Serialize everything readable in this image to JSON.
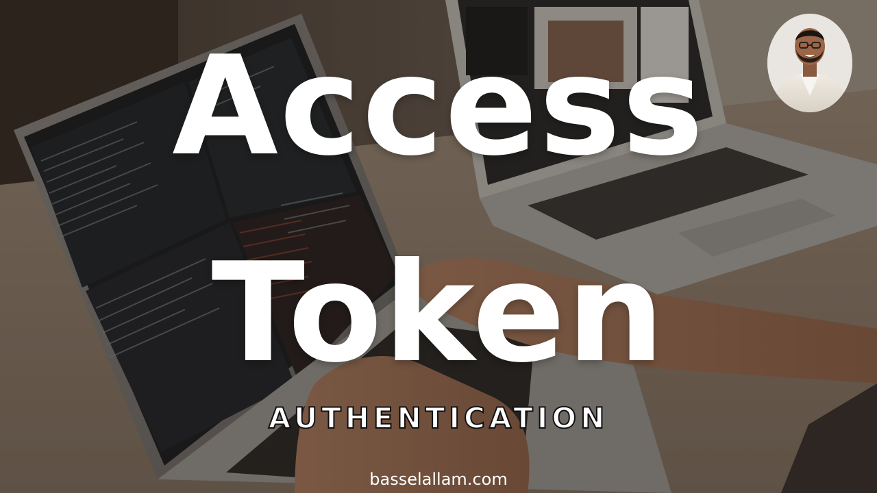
{
  "thumbnail": {
    "title_line_1": "Access",
    "title_line_2": "Token",
    "subtitle": "AUTHENTICATION",
    "website": "basselallam.com"
  },
  "colors": {
    "text": "#ffffff",
    "subtitle_outline": "#111111",
    "overlay": "#1a140f"
  },
  "icons": {
    "avatar": "presenter-portrait"
  }
}
